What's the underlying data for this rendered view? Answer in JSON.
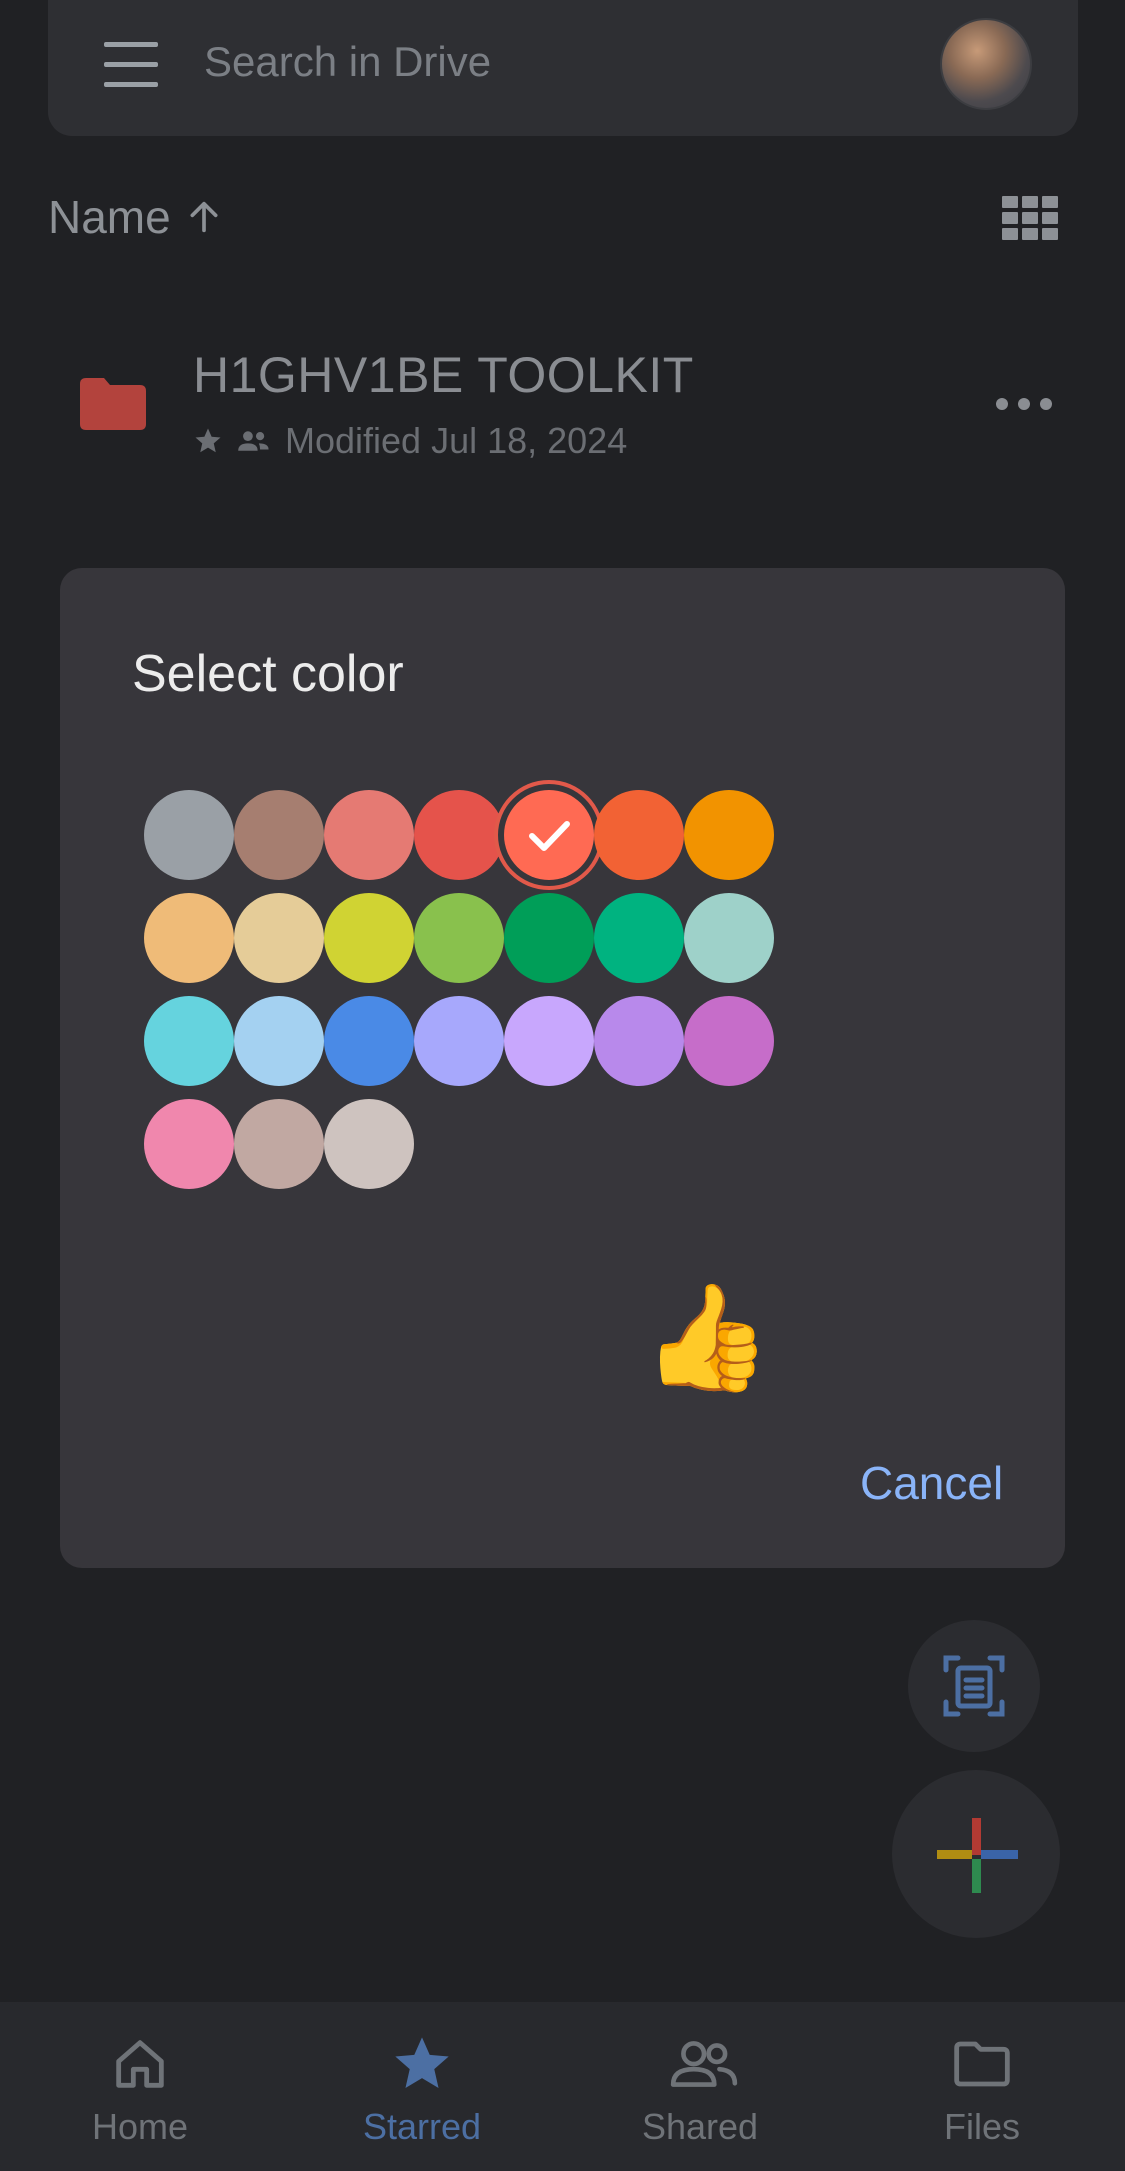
{
  "header": {
    "search_placeholder": "Search in Drive"
  },
  "sort": {
    "label": "Name",
    "direction_icon": "arrow-up-icon"
  },
  "file": {
    "name": "H1GHV1BE TOOLKIT",
    "modified": "Modified Jul 18, 2024",
    "folder_color": "#b3433d"
  },
  "dialog": {
    "title": "Select color",
    "cancel_label": "Cancel",
    "selected_index": 4,
    "colors": [
      "#9aa0a6",
      "#a67e70",
      "#e57a73",
      "#e5534b",
      "#ff6a53",
      "#f26234",
      "#f29300",
      "#efbb78",
      "#e5cc98",
      "#d0d333",
      "#89c14d",
      "#009e58",
      "#00b380",
      "#9ed1c9",
      "#65d3de",
      "#a4d1f1",
      "#4a8ae6",
      "#a7a8fc",
      "#c8a7fd",
      "#b889eb",
      "#c66dc9",
      "#f087ad",
      "#c1a8a2",
      "#cec3bf"
    ],
    "emoji": "👍"
  },
  "nav": {
    "items": [
      {
        "label": "Home",
        "icon": "home-icon"
      },
      {
        "label": "Starred",
        "icon": "star-icon"
      },
      {
        "label": "Shared",
        "icon": "people-icon"
      },
      {
        "label": "Files",
        "icon": "folder-icon"
      }
    ],
    "active_index": 1,
    "active_color": "#4c6fa3"
  }
}
